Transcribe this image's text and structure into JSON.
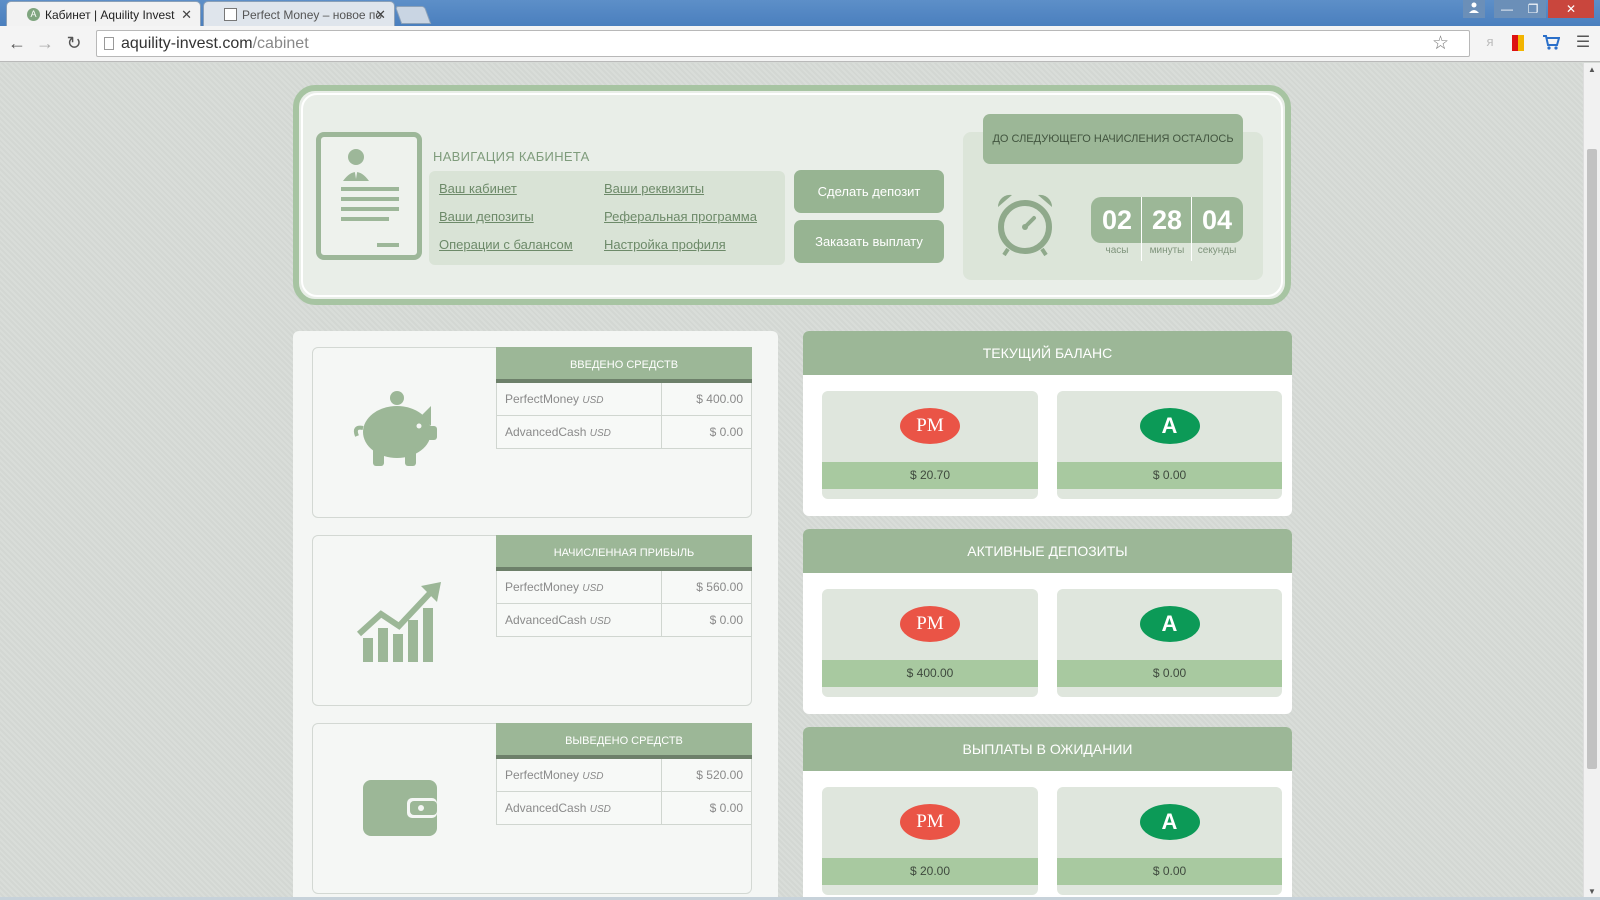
{
  "browser": {
    "tabs": [
      {
        "title": "Кабинет | Aquility Invest",
        "active": true
      },
      {
        "title": "Perfect Money – новое по",
        "active": false
      }
    ],
    "close_glyph": "✕",
    "url_domain": "aquility-invest.com",
    "url_path": "/cabinet",
    "window_controls": [
      "—",
      "❐",
      "✕"
    ]
  },
  "nav": {
    "title": "НАВИГАЦИЯ КАБИНЕТА",
    "links": [
      "Ваш кабинет",
      "Ваши депозиты",
      "Операции с балансом",
      "Ваши реквизиты",
      "Реферальная программа",
      "Настройка профиля"
    ],
    "deposit_button": "Сделать депозит",
    "withdraw_button": "Заказать выплату"
  },
  "timer": {
    "heading": "ДО СЛЕДУЮЩЕГО НАЧИСЛЕНИЯ ОСТАЛОСЬ",
    "hours": "02",
    "minutes": "28",
    "seconds": "04",
    "hours_label": "часы",
    "minutes_label": "минуты",
    "seconds_label": "секунды"
  },
  "stats": [
    {
      "title": "ВВЕДЕНО СРЕДСТВ",
      "icon": "piggy-bank-icon",
      "rows": [
        {
          "system": "PerfectMoney",
          "currency": "USD",
          "amount": "$ 400.00"
        },
        {
          "system": "AdvancedCash",
          "currency": "USD",
          "amount": "$ 0.00"
        }
      ]
    },
    {
      "title": "НАЧИСЛЕННАЯ ПРИБЫЛЬ",
      "icon": "growth-chart-icon",
      "rows": [
        {
          "system": "PerfectMoney",
          "currency": "USD",
          "amount": "$ 560.00"
        },
        {
          "system": "AdvancedCash",
          "currency": "USD",
          "amount": "$ 0.00"
        }
      ]
    },
    {
      "title": "ВЫВЕДЕНО СРЕДСТВ",
      "icon": "wallet-icon",
      "rows": [
        {
          "system": "PerfectMoney",
          "currency": "USD",
          "amount": "$ 520.00"
        },
        {
          "system": "AdvancedCash",
          "currency": "USD",
          "amount": "$ 0.00"
        }
      ]
    }
  ],
  "balances": [
    {
      "title": "ТЕКУЩИЙ БАЛАНС",
      "pm": "$ 20.70",
      "ac": "$ 0.00"
    },
    {
      "title": "АКТИВНЫЕ ДЕПОЗИТЫ",
      "pm": "$ 400.00",
      "ac": "$ 0.00"
    },
    {
      "title": "ВЫПЛАТЫ В ОЖИДАНИИ",
      "pm": "$ 20.00",
      "ac": "$ 0.00"
    }
  ],
  "logos": {
    "pm": "PM",
    "ac": "A"
  },
  "colors": {
    "accent_green": "#9cb797",
    "pm_red": "#ea5446",
    "ac_green": "#0c9a57",
    "amount_bar": "#a8c9a0"
  }
}
